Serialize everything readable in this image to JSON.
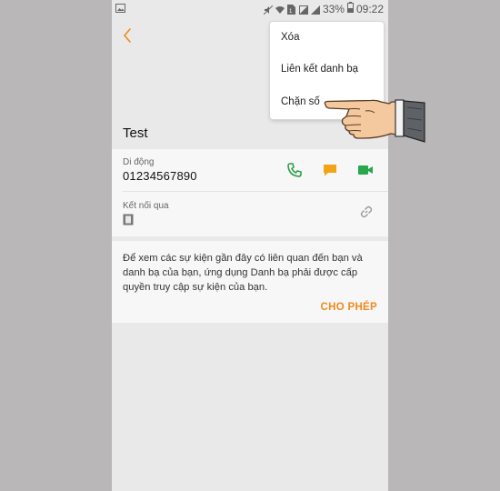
{
  "statusbar": {
    "battery": "33%",
    "time": "09:22"
  },
  "contact": {
    "name": "Test"
  },
  "phone": {
    "label": "Di động",
    "number": "01234567890"
  },
  "linked": {
    "label": "Kết nối qua"
  },
  "info": {
    "text": "Để xem các sự kiện gần đây có liên quan đến bạn và danh bạ của bạn, ứng dụng Danh bạ phải được cấp quyền truy cập sự kiện của bạn.",
    "allow_label": "CHO PHÉP"
  },
  "menu": {
    "items": [
      "Xóa",
      "Liên kết danh bạ",
      "Chặn số"
    ]
  },
  "colors": {
    "accent": "#f08a1c",
    "call_green": "#2e9e4a",
    "message_orange": "#f2a417",
    "video_green": "#29a74c"
  },
  "icons": [
    "back-arrow-icon",
    "phone-icon",
    "message-icon",
    "video-call-icon",
    "link-icon",
    "device-icon",
    "pointing-hand-icon"
  ]
}
